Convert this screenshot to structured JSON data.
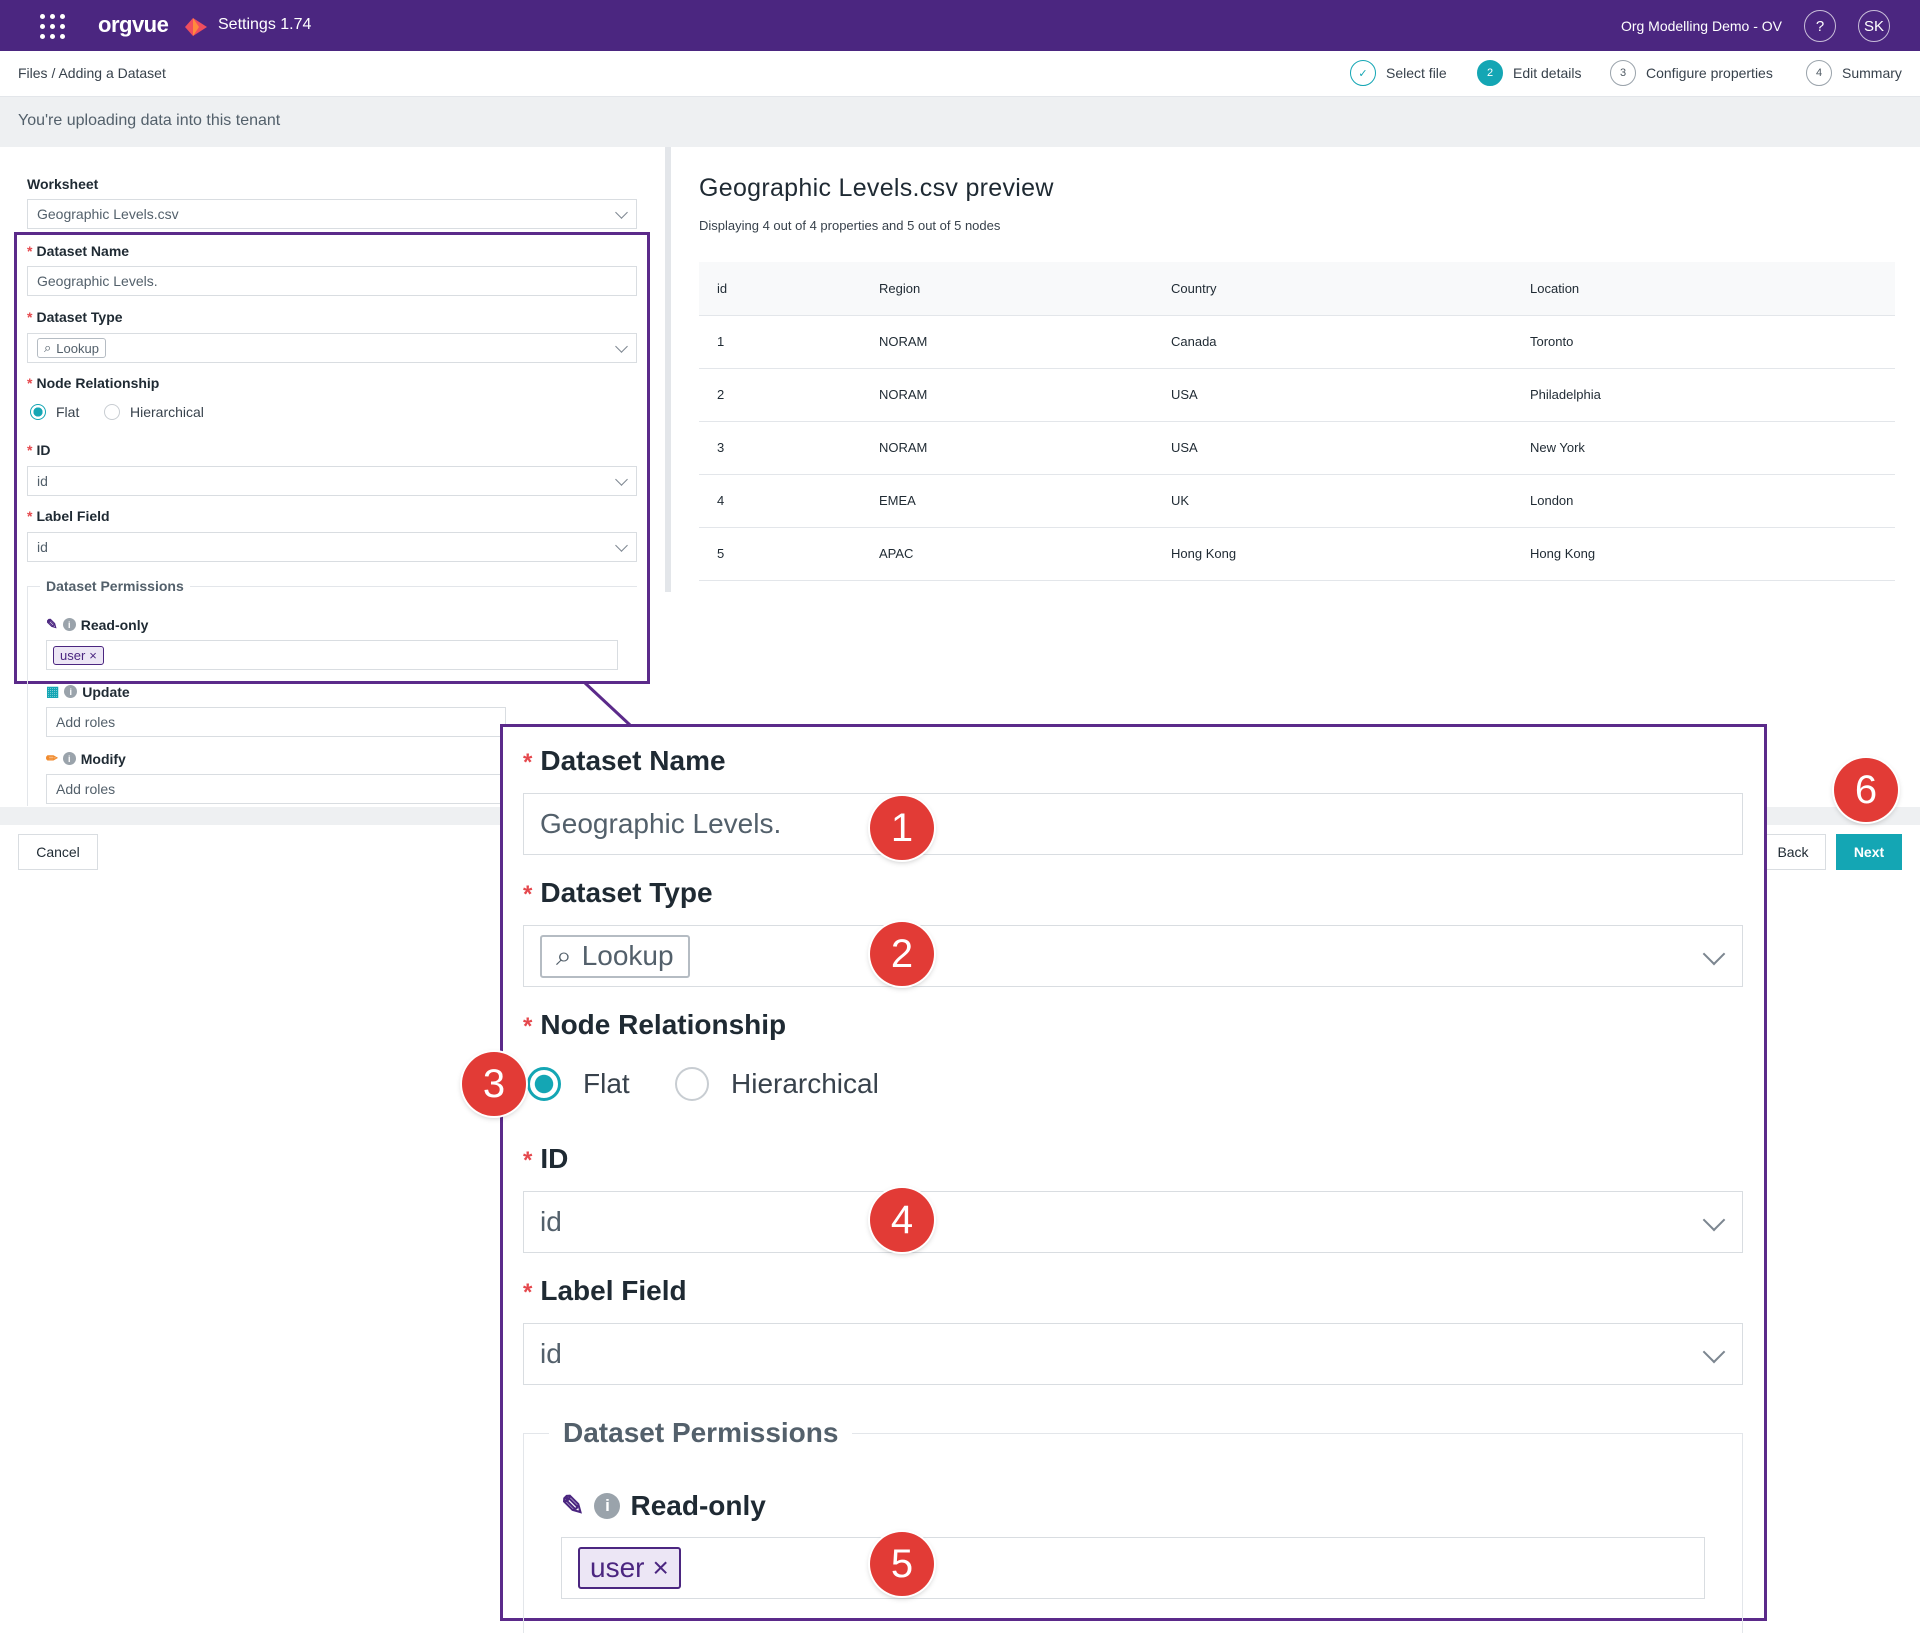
{
  "topbar": {
    "brand": "orgvue",
    "app_title": "Settings  1.74",
    "tenant": "Org Modelling Demo - OV",
    "help": "?",
    "avatar": "SK"
  },
  "breadcrumb": "Files / Adding a Dataset",
  "steps": [
    {
      "num": "✓",
      "label": "Select file"
    },
    {
      "num": "2",
      "label": "Edit details"
    },
    {
      "num": "3",
      "label": "Configure properties"
    },
    {
      "num": "4",
      "label": "Summary"
    }
  ],
  "banner": "You're uploading data into this tenant",
  "form": {
    "worksheet_label": "Worksheet",
    "worksheet_value": "Geographic Levels.csv",
    "dataset_name_label": "Dataset Name",
    "dataset_name_value": "Geographic Levels.",
    "dataset_type_label": "Dataset Type",
    "dataset_type_value": "Lookup",
    "node_rel_label": "Node Relationship",
    "flat": "Flat",
    "hierarchical": "Hierarchical",
    "id_label": "ID",
    "id_value": "id",
    "label_field_label": "Label Field",
    "label_field_value": "id",
    "permissions_label": "Dataset Permissions",
    "readonly_label": "Read-only",
    "readonly_tag": "user",
    "update_label": "Update",
    "update_placeholder": "Add roles",
    "modify_label": "Modify",
    "modify_placeholder": "Add roles"
  },
  "preview": {
    "title": "Geographic Levels.csv preview",
    "subtitle": "Displaying 4 out of 4 properties and 5 out of 5 nodes",
    "columns": [
      "id",
      "Region",
      "Country",
      "Location"
    ],
    "rows": [
      [
        "1",
        "NORAM",
        "Canada",
        "Toronto"
      ],
      [
        "2",
        "NORAM",
        "USA",
        "Philadelphia"
      ],
      [
        "3",
        "NORAM",
        "USA",
        "New York"
      ],
      [
        "4",
        "EMEA",
        "UK",
        "London"
      ],
      [
        "5",
        "APAC",
        "Hong Kong",
        "Hong Kong"
      ]
    ]
  },
  "buttons": {
    "cancel": "Cancel",
    "back": "Back",
    "next": "Next"
  },
  "badges": [
    "1",
    "2",
    "3",
    "4",
    "5",
    "6"
  ],
  "colors": {
    "brand": "#4b2680",
    "accent": "#14a6b4",
    "required": "#e5484d",
    "badge": "#e23b36"
  }
}
